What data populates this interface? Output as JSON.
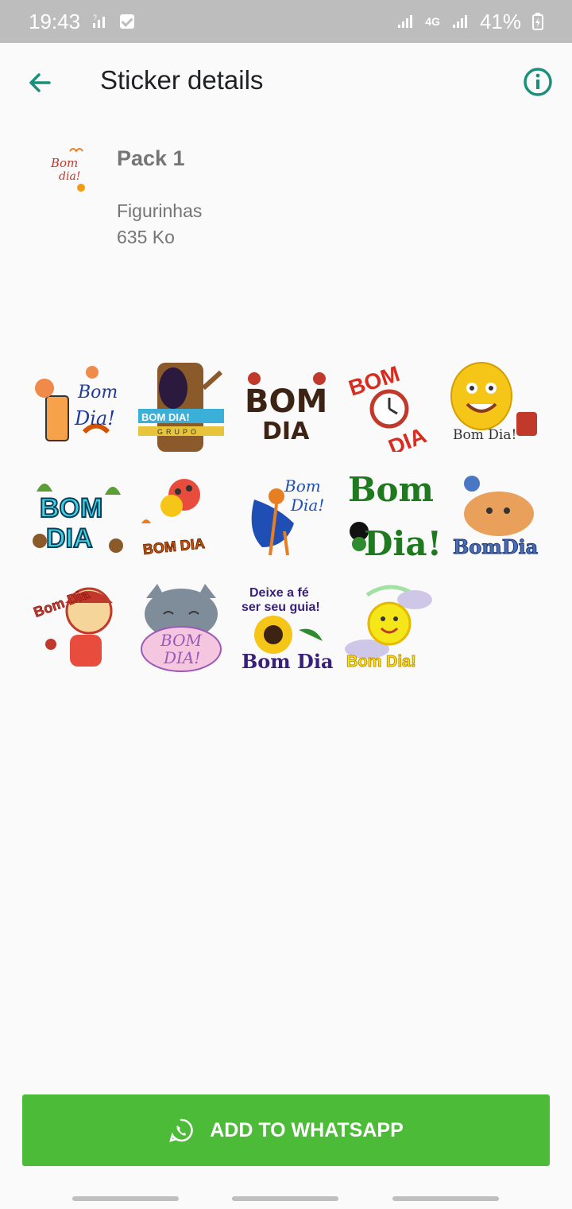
{
  "status_bar": {
    "time": "19:43",
    "network": "4G",
    "battery": "41%"
  },
  "appbar": {
    "title": "Sticker details",
    "back_icon": "arrow-left-icon",
    "info_icon": "info-icon"
  },
  "pack": {
    "name": "Pack 1",
    "publisher": "Figurinhas",
    "size": "635 Ko",
    "tray_text": [
      "Bom",
      "dia!"
    ]
  },
  "stickers": [
    {
      "texts": [
        "Bom",
        "Dia!"
      ]
    },
    {
      "texts": [
        "BOM DIA!",
        "GRUPO"
      ]
    },
    {
      "texts": [
        "BOM",
        "DIA"
      ]
    },
    {
      "texts": [
        "BOM",
        "DIA"
      ]
    },
    {
      "texts": [
        "Bom Dia!"
      ]
    },
    {
      "texts": [
        "BOM",
        "DIA"
      ]
    },
    {
      "texts": [
        "BOM DIA"
      ]
    },
    {
      "texts": [
        "Bom",
        "Dia!"
      ]
    },
    {
      "texts": [
        "Bom",
        "Dia!"
      ]
    },
    {
      "texts": [
        "BomDia"
      ]
    },
    {
      "texts": [
        "Bom Dia"
      ]
    },
    {
      "texts": [
        "BOM",
        "DIA!"
      ]
    },
    {
      "texts": [
        "Deixe a fé",
        "ser seu guia!",
        "Bom Dia"
      ]
    },
    {
      "texts": [
        "Bom Dia!"
      ]
    }
  ],
  "action": {
    "label": "ADD TO WHATSAPP",
    "icon": "whatsapp-icon",
    "color": "#4cbb38"
  },
  "colors": {
    "accent": "#1a8f7a",
    "status_bar": "#bdbdbd",
    "background": "#fafafa"
  }
}
